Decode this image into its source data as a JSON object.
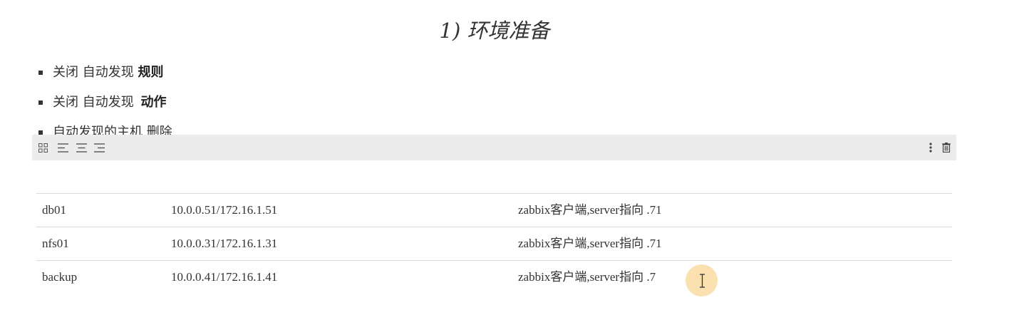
{
  "heading": "1) 环境准备",
  "bullets": [
    {
      "text": "关闭 自动发现",
      "bold": "规则",
      "gap": false
    },
    {
      "text": "关闭 自动发现",
      "bold": "动作",
      "gap": true
    },
    {
      "text": "自动发现的主机 删除",
      "bold": "",
      "gap": false
    }
  ],
  "toolbar": {
    "left_icons": [
      "grid-icon",
      "align-left-icon",
      "align-center-icon",
      "align-right-icon"
    ],
    "right_icons": [
      "more-vertical-icon",
      "trash-icon"
    ]
  },
  "table": {
    "rows": [
      [
        "db01",
        "10.0.0.51/172.16.1.51",
        "zabbix客户端,server指向 .71"
      ],
      [
        "nfs01",
        "10.0.0.31/172.16.1.31",
        "zabbix客户端,server指向 .71"
      ],
      [
        "backup",
        "10.0.0.41/172.16.1.41",
        "zabbix客户端,server指向 .7"
      ]
    ]
  },
  "colors": {
    "toolbar_bg": "#ececec",
    "cursor_halo": "#f5c86e"
  }
}
